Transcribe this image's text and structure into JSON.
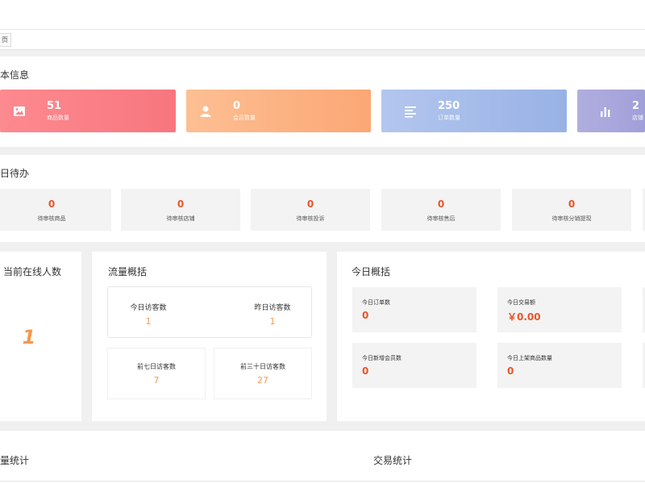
{
  "tabs": {
    "active_label": "页"
  },
  "basic_info": {
    "title": "本信息",
    "cards": [
      {
        "value": "51",
        "label": "商品数量",
        "icon": "image-icon"
      },
      {
        "value": "0",
        "label": "会员数量",
        "icon": "user-icon"
      },
      {
        "value": "250",
        "label": "订单数量",
        "icon": "list-icon"
      },
      {
        "value": "2",
        "label": "店铺",
        "icon": "bar-chart-icon"
      }
    ]
  },
  "todo": {
    "title": "日待办",
    "items": [
      {
        "value": "0",
        "label": "待审核商品"
      },
      {
        "value": "0",
        "label": "待审核店铺"
      },
      {
        "value": "0",
        "label": "待审核投诉"
      },
      {
        "value": "0",
        "label": "待审核售后"
      },
      {
        "value": "0",
        "label": "待审核分销提现"
      }
    ]
  },
  "online": {
    "title": "当前在线人数",
    "value": "1"
  },
  "traffic": {
    "title": "流量概括",
    "today_label": "今日访客数",
    "today_value": "1",
    "yesterday_label": "昨日访客数",
    "yesterday_value": "1",
    "week_label": "前七日访客数",
    "week_value": "7",
    "month_label": "前三十日访客数",
    "month_value": "27"
  },
  "today": {
    "title": "今日概括",
    "items": [
      {
        "label": "今日订单数",
        "value": "0"
      },
      {
        "label": "今日交易额",
        "value": "￥0.00"
      },
      {
        "label": "今日新增会员数",
        "value": "0"
      },
      {
        "label": "今日上架商品数量",
        "value": "0"
      }
    ]
  },
  "bottom": {
    "left_title": "量统计",
    "right_title": "交易统计"
  },
  "colors": {
    "accent_red": "#e8552a",
    "accent_orange": "#f39a4e",
    "card1": "#fb7a82",
    "card2": "#fbb486",
    "card3": "#9fb7e8",
    "card4": "#a9a8dc"
  }
}
